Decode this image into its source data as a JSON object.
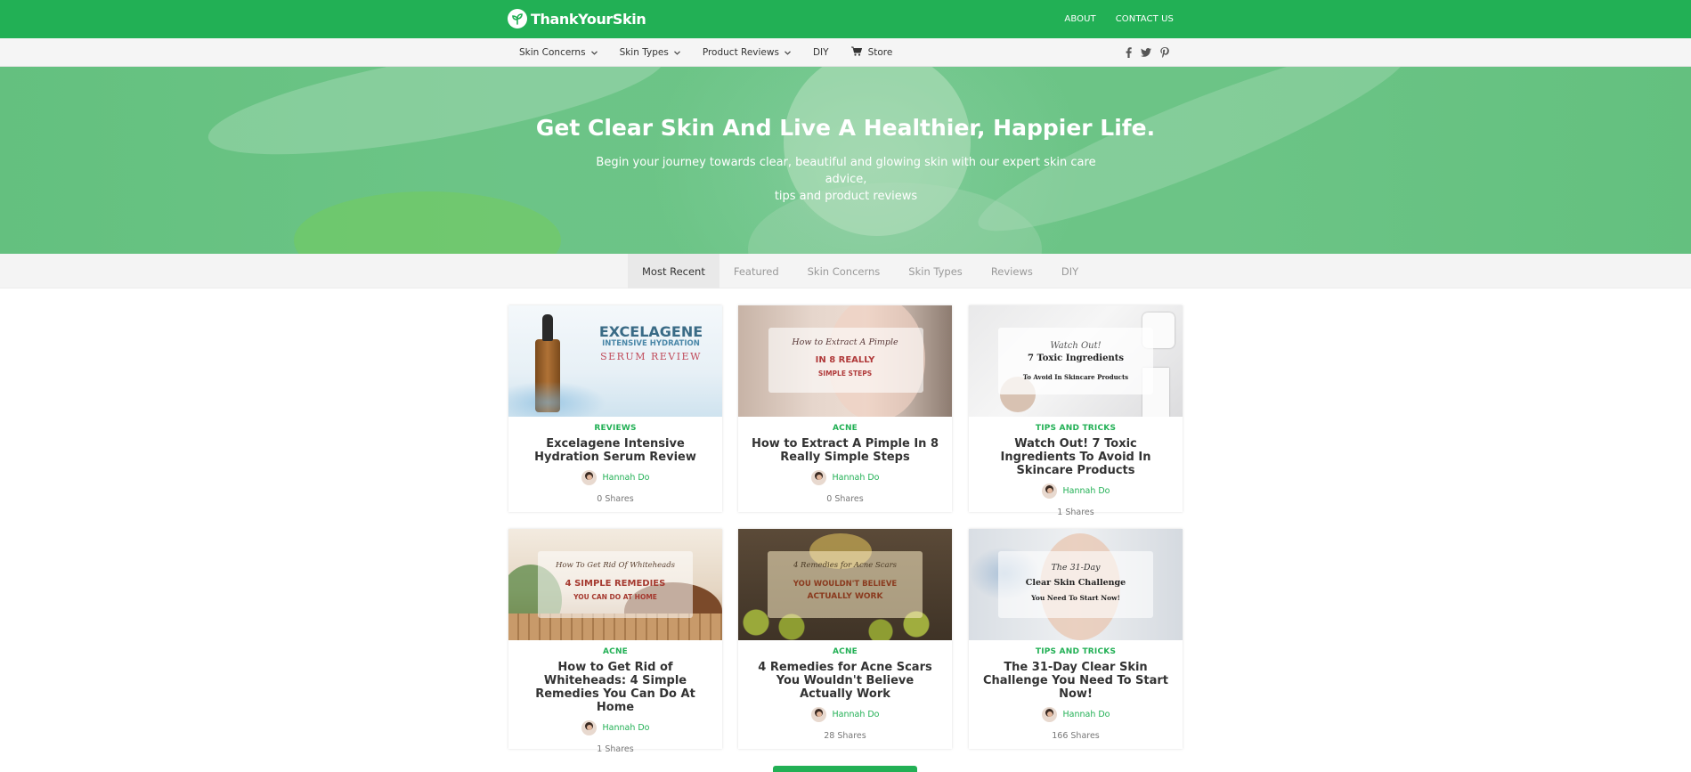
{
  "header": {
    "logo_text": "ThankYourSkin",
    "links": [
      "ABOUT",
      "CONTACT US"
    ]
  },
  "nav": {
    "items": [
      {
        "label": "Skin Concerns",
        "caret": true
      },
      {
        "label": "Skin Types",
        "caret": true
      },
      {
        "label": "Product Reviews",
        "caret": true
      },
      {
        "label": "DIY",
        "caret": false
      }
    ],
    "store_label": "Store",
    "social": [
      "facebook-icon",
      "twitter-icon",
      "pinterest-icon"
    ]
  },
  "hero": {
    "title": "Get Clear Skin And Live A Healthier, Happier Life.",
    "subtitle_line1": "Begin your journey towards clear, beautiful and glowing skin with our expert skin care advice,",
    "subtitle_line2": "tips and product reviews"
  },
  "tabs": [
    "Most Recent",
    "Featured",
    "Skin Concerns",
    "Skin Types",
    "Reviews",
    "DIY"
  ],
  "active_tab": "Most Recent",
  "posts": [
    {
      "category": "REVIEWS",
      "title": "Excelagene Intensive Hydration Serum Review",
      "author": "Hannah Do",
      "shares": "0 Shares",
      "thumb": {
        "lines": [
          "EXCELAGENE",
          "INTENSIVE HYDRATION",
          "SERUM REVIEW"
        ]
      }
    },
    {
      "category": "ACNE",
      "title": "How to Extract A Pimple In 8 Really Simple Steps",
      "author": "Hannah Do",
      "shares": "0 Shares",
      "thumb": {
        "lines": [
          "How to Extract A Pimple",
          "IN 8 REALLY",
          "SIMPLE STEPS"
        ]
      }
    },
    {
      "category": "TIPS AND TRICKS",
      "title": "Watch Out! 7 Toxic Ingredients To Avoid In Skincare Products",
      "author": "Hannah Do",
      "shares": "1 Shares",
      "thumb": {
        "lines": [
          "Watch Out!",
          "7 Toxic Ingredients",
          "To Avoid In Skincare Products"
        ]
      }
    },
    {
      "category": "ACNE",
      "title": "How to Get Rid of Whiteheads: 4 Simple Remedies You Can Do At Home",
      "author": "Hannah Do",
      "shares": "1 Shares",
      "thumb": {
        "lines": [
          "How To Get Rid Of Whiteheads",
          "4 SIMPLE REMEDIES",
          "YOU CAN DO AT HOME"
        ]
      }
    },
    {
      "category": "ACNE",
      "title": "4 Remedies for Acne Scars You Wouldn't Believe Actually Work",
      "author": "Hannah Do",
      "shares": "28 Shares",
      "thumb": {
        "lines": [
          "4 Remedies for Acne Scars",
          "YOU WOULDN'T BELIEVE",
          "ACTUALLY WORK"
        ]
      }
    },
    {
      "category": "TIPS AND TRICKS",
      "title": "The 31-Day Clear Skin Challenge You Need To Start Now!",
      "author": "Hannah Do",
      "shares": "166 Shares",
      "thumb": {
        "lines": [
          "The 31-Day",
          "Clear Skin Challenge",
          "You Need To Start Now!"
        ]
      }
    }
  ],
  "colors": {
    "brand": "#22b055",
    "text": "#333333",
    "muted": "#999999"
  }
}
